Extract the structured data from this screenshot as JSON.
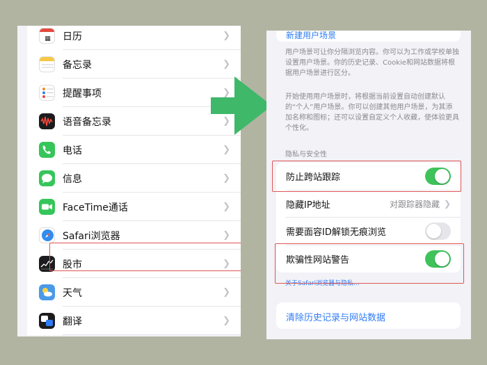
{
  "left_settings": {
    "rows": [
      {
        "label": "日历",
        "icon": "calendar-icon"
      },
      {
        "label": "备忘录",
        "icon": "notes-icon"
      },
      {
        "label": "提醒事项",
        "icon": "reminders-icon"
      },
      {
        "label": "语音备忘录",
        "icon": "voice-memos-icon"
      },
      {
        "label": "电话",
        "icon": "phone-icon"
      },
      {
        "label": "信息",
        "icon": "messages-icon"
      },
      {
        "label": "FaceTime通话",
        "icon": "facetime-icon"
      },
      {
        "label": "Safari浏览器",
        "icon": "safari-icon"
      },
      {
        "label": "股市",
        "icon": "stocks-icon"
      },
      {
        "label": "天气",
        "icon": "weather-icon"
      },
      {
        "label": "翻译",
        "icon": "translate-icon"
      }
    ],
    "highlighted_row": "Safari浏览器"
  },
  "right_settings": {
    "new_profile_link": "新建用户场景",
    "profiles_note_1": "用户场景可让你分隔浏览内容。你可以为工作或学校单独设置用户场景。你的历史记录、Cookie和网站数据将根据用户场景进行区分。",
    "profiles_note_2": "开始使用用户场景时，将根据当前设置自动创建默认的“个人”用户场景。你可以创建其他用户场景，为其添加名称和图标；还可以设置自定义个人收藏，使体验更具个性化。",
    "privacy_section_title": "隐私与安全性",
    "privacy_rows": {
      "prevent_tracking": {
        "label": "防止跨站跟踪",
        "toggle_on": true
      },
      "hide_ip": {
        "label": "隐藏IP地址",
        "value": "对跟踪器隐藏"
      },
      "faceid_private": {
        "label": "需要面容ID解锁无痕浏览",
        "toggle_on": false
      },
      "fraud_warning": {
        "label": "欺骗性网站警告",
        "toggle_on": true
      }
    },
    "about_link": "关于Safari浏览器与隐私...",
    "clear_history_link": "清除历史记录与网站数据"
  },
  "colors": {
    "accent_link": "#2f7cf6",
    "toggle_on": "#3fc25a",
    "highlight_border": "#e05454",
    "arrow": "#3fb86a"
  }
}
